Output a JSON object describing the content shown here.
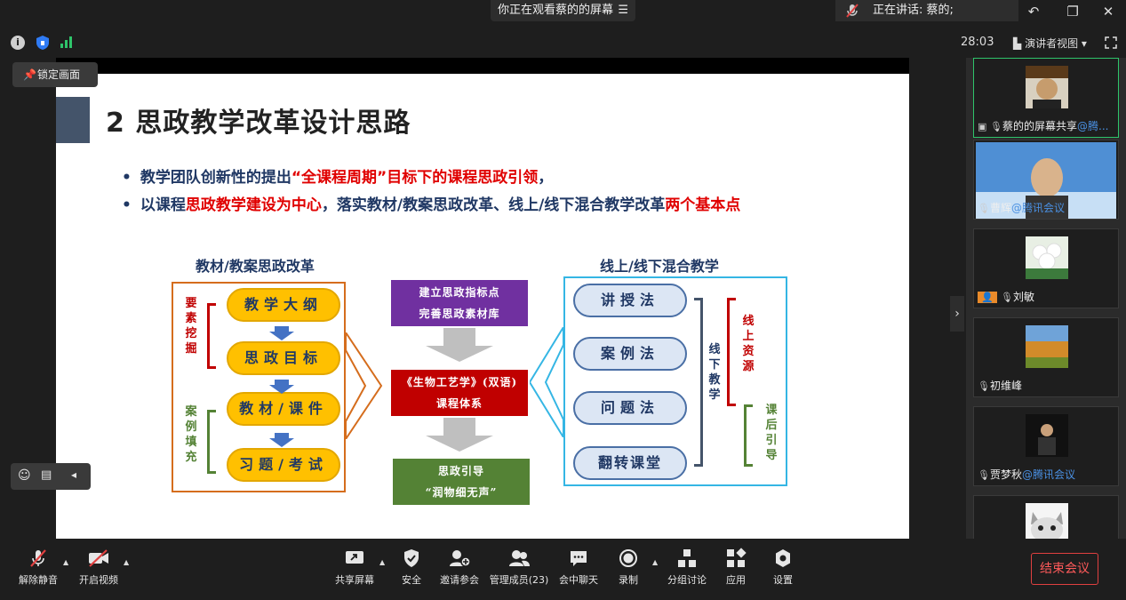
{
  "topbar": {
    "share_text": "你正在观看蔡的的屏幕",
    "speaking_text": "正在讲话: 蔡的;"
  },
  "infobar": {
    "timer": "28:03",
    "view_label": "演讲者视图"
  },
  "lock_label": "锁定画面",
  "slide": {
    "title": "2 思政教学改革设计思路",
    "bullet1": {
      "part1": "教学团队创新性的提出",
      "part2": "“全课程周期”目标下的课程思政引领",
      "part3": "，"
    },
    "bullet2": {
      "part1": "以课程",
      "part2": "思政教学建设为中心",
      "part3": "，落实教材/教案思政改革、线上/线下混合教学改革",
      "part4": "两个基本点"
    },
    "left_title": "教材/教案思政改革",
    "left_pills": [
      "教学大纲",
      "思政目标",
      "教材/课件",
      "习题/考试"
    ],
    "left_group1": "要素挖掘",
    "left_group2": "案例填充",
    "mid_top1": "建立思政指标点",
    "mid_top2": "完善思政素材库",
    "mid_center1": "《生物工艺学》(双语)",
    "mid_center2": "课程体系",
    "mid_bottom1": "思政引导",
    "mid_bottom2": "“润物细无声”",
    "right_title": "线上/线下混合教学",
    "right_pills": [
      "讲授法",
      "案例法",
      "问题法",
      "翻转课堂"
    ],
    "right_group1": "线下教学",
    "right_group2": "线上资源",
    "right_group3": "课后引导"
  },
  "participants": [
    {
      "name": "蔡的的屏幕共享",
      "tag": "@腾..."
    },
    {
      "name": "曹辉",
      "tag": "@腾讯会议"
    },
    {
      "name": "刘敏",
      "tag": ""
    },
    {
      "name": "初维峰",
      "tag": ""
    },
    {
      "name": "贾梦秋",
      "tag": "@腾讯会议"
    },
    {
      "name": "",
      "tag": ""
    }
  ],
  "toolbar": {
    "mute": "解除静音",
    "video": "开启视频",
    "share": "共享屏幕",
    "security": "安全",
    "invite": "邀请参会",
    "members": "管理成员(23)",
    "chat": "会中聊天",
    "record": "录制",
    "breakout": "分组讨论",
    "apps": "应用",
    "settings": "设置",
    "end": "结束会议"
  },
  "colors": {
    "accent_red": "#e00000",
    "navy": "#203864",
    "pill_yellow": "#ffc000",
    "mid_purple": "#7030a0",
    "mid_red": "#c00000",
    "mid_green": "#548235",
    "cyan": "#35b6e4",
    "orange": "#d56d1d"
  }
}
